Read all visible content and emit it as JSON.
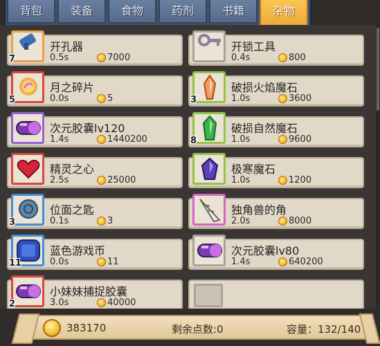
{
  "tabs": [
    {
      "label": "背包",
      "active": false
    },
    {
      "label": "装备",
      "active": false
    },
    {
      "label": "食物",
      "active": false
    },
    {
      "label": "药剂",
      "active": false
    },
    {
      "label": "书籍",
      "active": false
    },
    {
      "label": "杂物",
      "active": true
    }
  ],
  "items": [
    {
      "name": "开孔器",
      "time": "0.5s",
      "price": "7000",
      "count": "7",
      "icon": "drill-icon",
      "frame": "orange"
    },
    {
      "name": "开锁工具",
      "time": "0.4s",
      "price": "800",
      "count": "",
      "icon": "lockpick-icon",
      "frame": "gray"
    },
    {
      "name": "月之碎片",
      "time": "0.0s",
      "price": "5",
      "count": "5",
      "icon": "moon-shard-icon",
      "frame": "red"
    },
    {
      "name": "破损火焰魔石",
      "time": "1.0s",
      "price": "3600",
      "count": "3",
      "icon": "fire-crystal-icon",
      "frame": "green"
    },
    {
      "name": "次元胶囊lv120",
      "time": "1.4s",
      "price": "1440200",
      "count": "",
      "icon": "capsule-icon",
      "frame": "purple"
    },
    {
      "name": "破损自然魔石",
      "time": "1.0s",
      "price": "9600",
      "count": "8",
      "icon": "nature-crystal-icon",
      "frame": "green"
    },
    {
      "name": "精灵之心",
      "time": "2.5s",
      "price": "25000",
      "count": "",
      "icon": "heart-icon",
      "frame": "red"
    },
    {
      "name": "极寒魔石",
      "time": "1.0s",
      "price": "1200",
      "count": "",
      "icon": "frost-crystal-icon",
      "frame": "green"
    },
    {
      "name": "位面之匙",
      "time": "0.1s",
      "price": "3",
      "count": "3",
      "icon": "plane-key-icon",
      "frame": "blue"
    },
    {
      "name": "独角兽的角",
      "time": "2.0s",
      "price": "8000",
      "count": "",
      "icon": "unicorn-horn-icon",
      "frame": "pink"
    },
    {
      "name": "蓝色游戏币",
      "time": "0.0s",
      "price": "11",
      "count": "11",
      "icon": "blue-token-icon",
      "frame": "blue"
    },
    {
      "name": "次元胶囊lv80",
      "time": "1.4s",
      "price": "640200",
      "count": "",
      "icon": "capsule-icon",
      "frame": "gray"
    },
    {
      "name": "小妹妹捕捉胶囊",
      "time": "3.0s",
      "price": "40000",
      "count": "2",
      "icon": "capsule-icon",
      "frame": "red"
    },
    {
      "name": "",
      "time": "",
      "price": "",
      "count": "",
      "icon": "empty-slot-icon",
      "frame": "gray",
      "empty": true
    }
  ],
  "footer": {
    "gold": "383170",
    "points": "剩余点数:0",
    "capacity": "容量：132/140"
  }
}
